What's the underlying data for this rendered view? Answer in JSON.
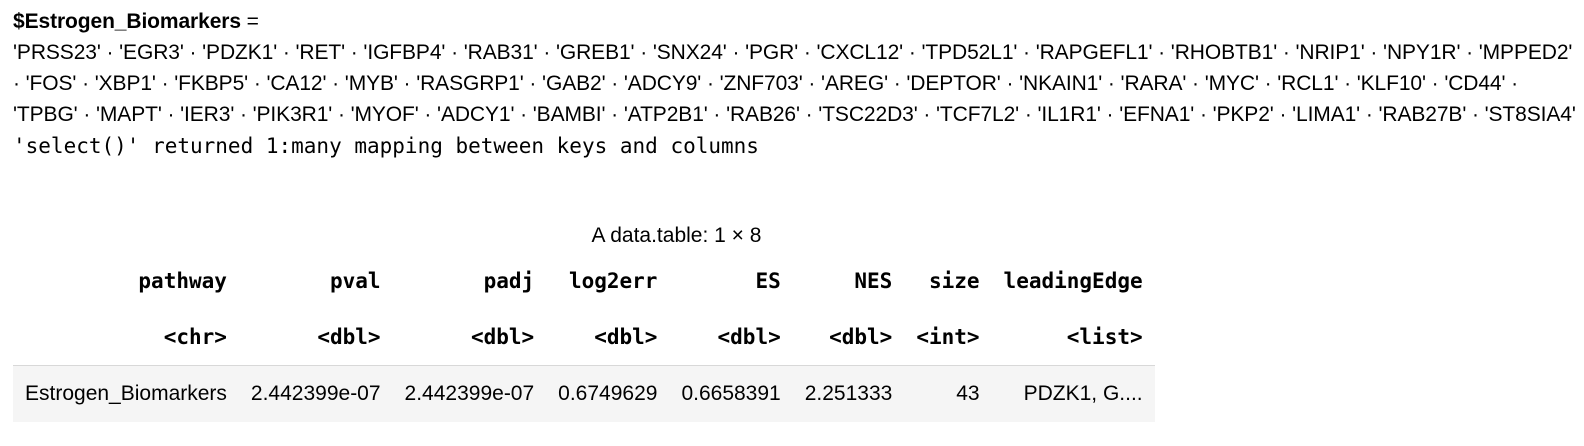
{
  "list": {
    "name": "$Estrogen_Biomarkers",
    "assign": " =",
    "items": [
      "'PRSS23'",
      "'EGR3'",
      "'PDZK1'",
      "'RET'",
      "'IGFBP4'",
      "'RAB31'",
      "'GREB1'",
      "'SNX24'",
      "'PGR'",
      "'CXCL12'",
      "'TPD52L1'",
      "'RAPGEFL1'",
      "'RHOBTB1'",
      "'NRIP1'",
      "'NPY1R'",
      "'MPPED2'",
      "'FOS'",
      "'XBP1'",
      "'FKBP5'",
      "'CA12'",
      "'MYB'",
      "'RASGRP1'",
      "'GAB2'",
      "'ADCY9'",
      "'ZNF703'",
      "'AREG'",
      "'DEPTOR'",
      "'NKAIN1'",
      "'RARA'",
      "'MYC'",
      "'RCL1'",
      "'KLF10'",
      "'CD44'",
      "'TPBG'",
      "'MAPT'",
      "'IER3'",
      "'PIK3R1'",
      "'MYOF'",
      "'ADCY1'",
      "'BAMBI'",
      "'ATP2B1'",
      "'RAB26'",
      "'TSC22D3'",
      "'TCF7L2'",
      "'IL1R1'",
      "'EFNA1'",
      "'PKP2'",
      "'LIMA1'",
      "'RAB27B'",
      "'ST8SIA4'"
    ],
    "separator": " · "
  },
  "stderr": "'select()' returned 1:many mapping between keys and columns",
  "table": {
    "caption": "A data.table: 1 × 8",
    "columns": [
      "pathway",
      "pval",
      "padj",
      "log2err",
      "ES",
      "NES",
      "size",
      "leadingEdge"
    ],
    "types": [
      "<chr>",
      "<dbl>",
      "<dbl>",
      "<dbl>",
      "<dbl>",
      "<dbl>",
      "<int>",
      "<list>"
    ],
    "row": [
      "Estrogen_Biomarkers",
      "2.442399e-07",
      "2.442399e-07",
      "0.6749629",
      "0.6658391",
      "2.251333",
      "43",
      "PDZK1, G...."
    ]
  }
}
